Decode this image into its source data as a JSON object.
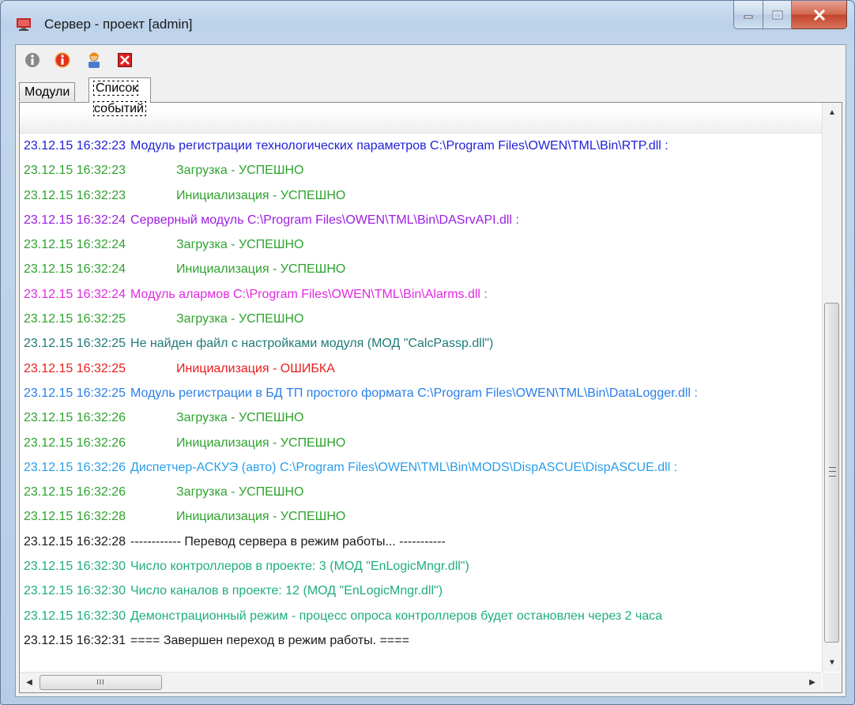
{
  "window": {
    "title": "Сервер - проект [admin]"
  },
  "toolbar": {
    "buttons": [
      {
        "icon": "info-gray-icon"
      },
      {
        "icon": "info-red-icon"
      },
      {
        "icon": "user-icon"
      },
      {
        "icon": "close-red-icon"
      }
    ]
  },
  "tabs": [
    {
      "label": "Модули",
      "active": false
    },
    {
      "label": "Список событий",
      "active": true
    }
  ],
  "log": [
    {
      "time": "23.12.15 16:32:23",
      "text": "Модуль регистрации технологических параметров C:\\Program Files\\OWEN\\TML\\Bin\\RTP.dll :",
      "color": "#1f1fd8",
      "indent": false
    },
    {
      "time": "23.12.15 16:32:23",
      "text": "Загрузка -  УСПЕШНО",
      "color": "#2ea32e",
      "indent": true
    },
    {
      "time": "23.12.15 16:32:23",
      "text": "Инициализация  - УСПЕШНО",
      "color": "#2ea32e",
      "indent": true
    },
    {
      "time": "23.12.15 16:32:24",
      "text": "Серверный модуль C:\\Program Files\\OWEN\\TML\\Bin\\DASrvAPI.dll :",
      "color": "#9b1ee0",
      "indent": false
    },
    {
      "time": "23.12.15 16:32:24",
      "text": "Загрузка -  УСПЕШНО",
      "color": "#2ea32e",
      "indent": true
    },
    {
      "time": "23.12.15 16:32:24",
      "text": "Инициализация  - УСПЕШНО",
      "color": "#2ea32e",
      "indent": true
    },
    {
      "time": "23.12.15 16:32:24",
      "text": "Модуль алармов C:\\Program Files\\OWEN\\TML\\Bin\\Alarms.dll :",
      "color": "#e22ae2",
      "indent": false
    },
    {
      "time": "23.12.15 16:32:25",
      "text": "Загрузка -  УСПЕШНО",
      "color": "#2ea32e",
      "indent": true
    },
    {
      "time": "23.12.15 16:32:25",
      "text": "Не найден файл с настройками модуля (МОД \"CalcPassp.dll\")",
      "color": "#207a7a",
      "indent": false
    },
    {
      "time": "23.12.15 16:32:25",
      "text": "Инициализация  - ОШИБКА",
      "color": "#ec1c1c",
      "indent": true
    },
    {
      "time": "23.12.15 16:32:25",
      "text": "Модуль регистрации в БД ТП простого формата C:\\Program Files\\OWEN\\TML\\Bin\\DataLogger.dll :",
      "color": "#2a7ee8",
      "indent": false
    },
    {
      "time": "23.12.15 16:32:26",
      "text": "Загрузка -  УСПЕШНО",
      "color": "#2ea32e",
      "indent": true
    },
    {
      "time": "23.12.15 16:32:26",
      "text": "Инициализация  - УСПЕШНО",
      "color": "#2ea32e",
      "indent": true
    },
    {
      "time": "23.12.15 16:32:26",
      "text": "Диспетчер-АСКУЭ (авто) C:\\Program Files\\OWEN\\TML\\Bin\\MODS\\DispASCUE\\DispASCUE.dll :",
      "color": "#2a9ee8",
      "indent": false
    },
    {
      "time": "23.12.15 16:32:26",
      "text": "Загрузка -  УСПЕШНО",
      "color": "#2ea32e",
      "indent": true
    },
    {
      "time": "23.12.15 16:32:28",
      "text": "Инициализация  - УСПЕШНО",
      "color": "#2ea32e",
      "indent": true
    },
    {
      "time": "23.12.15 16:32:28",
      "text": "------------ Перевод сервера в режим работы... -----------",
      "color": "#1a1a1a",
      "indent": false
    },
    {
      "time": "23.12.15 16:32:30",
      "text": "Число контроллеров в проекте: 3 (МОД \"EnLogicMngr.dll\")",
      "color": "#1fae7a",
      "indent": false
    },
    {
      "time": "23.12.15 16:32:30",
      "text": "Число каналов в проекте: 12 (МОД \"EnLogicMngr.dll\")",
      "color": "#1fae7a",
      "indent": false
    },
    {
      "time": "23.12.15 16:32:30",
      "text": "Демонстрационный режим - процесс опроса контроллеров будет остановлен через 2 часа",
      "color": "#1fae7a",
      "indent": false
    },
    {
      "time": "23.12.15 16:32:31",
      "text": "==== Завершен переход в режим работы. ====",
      "color": "#1a1a1a",
      "indent": false
    }
  ],
  "scroll": {
    "hthumb_label": "III",
    "up_arrow": "▲",
    "down_arrow": "▼",
    "left_arrow": "◀",
    "right_arrow": "▶"
  }
}
